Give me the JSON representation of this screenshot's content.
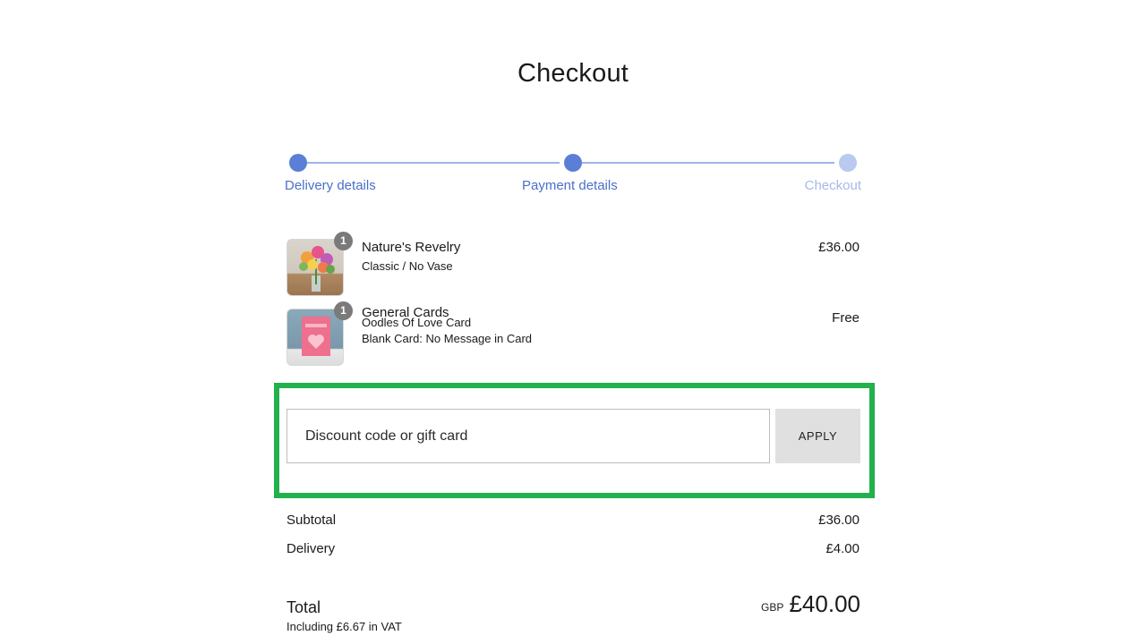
{
  "page": {
    "title": "Checkout"
  },
  "stepper": {
    "steps": [
      {
        "label": "Delivery details",
        "state": "complete"
      },
      {
        "label": "Payment details",
        "state": "active"
      },
      {
        "label": "Checkout",
        "state": "upcoming"
      }
    ]
  },
  "items": [
    {
      "name": "Nature's Revelry",
      "lines": [
        "Classic / No Vase"
      ],
      "quantity": "1",
      "price": "£36.00",
      "thumbnail": "flower-bouquet-image"
    },
    {
      "name": "General Cards",
      "lines": [
        "Oodles Of Love Card",
        "Blank Card: No Message in Card"
      ],
      "quantity": "1",
      "price": "Free",
      "thumbnail": "greeting-card-image"
    }
  ],
  "discount": {
    "placeholder": "Discount code or gift card",
    "value": "",
    "apply_label": "APPLY",
    "highlight_color": "#22b14c"
  },
  "totals": {
    "subtotal_label": "Subtotal",
    "subtotal_value": "£36.00",
    "delivery_label": "Delivery",
    "delivery_value": "£4.00",
    "total_label": "Total",
    "vat_note": "Including £6.67 in VAT",
    "currency": "GBP",
    "total_value": "£40.00"
  },
  "colors": {
    "step_active": "#5b7fd6",
    "step_upcoming": "#b9c9ef",
    "step_label_active": "#4a6fc9"
  }
}
